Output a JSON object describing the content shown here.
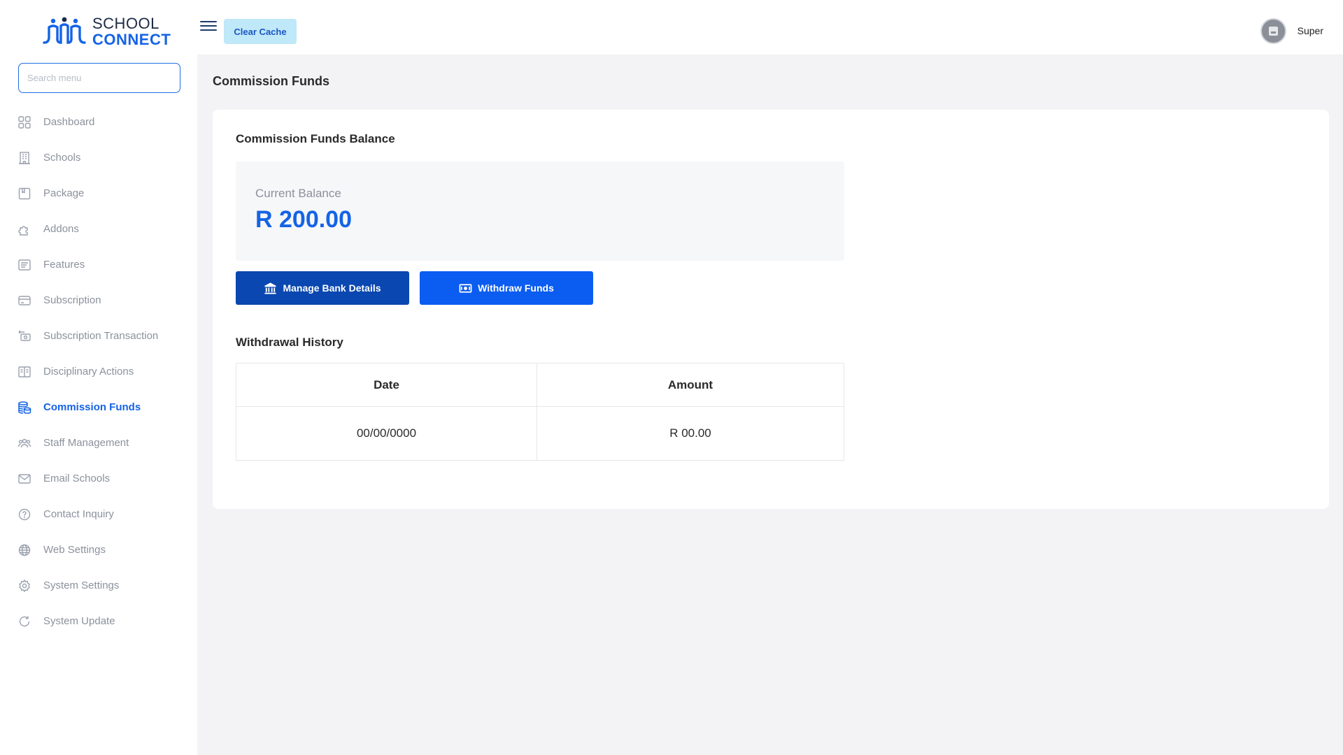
{
  "logo": {
    "line1": "SCHOOL",
    "line2": "CONNECT",
    "brand_color": "#1563e6"
  },
  "sidebar": {
    "search_placeholder": "Search menu",
    "items": [
      {
        "label": "Dashboard",
        "icon": "grid-icon",
        "active": false
      },
      {
        "label": "Schools",
        "icon": "building-icon",
        "active": false
      },
      {
        "label": "Package",
        "icon": "package-icon",
        "active": false
      },
      {
        "label": "Addons",
        "icon": "puzzle-icon",
        "active": false
      },
      {
        "label": "Features",
        "icon": "list-icon",
        "active": false
      },
      {
        "label": "Subscription",
        "icon": "card-icon",
        "active": false
      },
      {
        "label": "Subscription Transaction",
        "icon": "transaction-icon",
        "active": false
      },
      {
        "label": "Disciplinary Actions",
        "icon": "book-icon",
        "active": false
      },
      {
        "label": "Commission Funds",
        "icon": "coins-icon",
        "active": true
      },
      {
        "label": "Staff Management",
        "icon": "users-icon",
        "active": false
      },
      {
        "label": "Email Schools",
        "icon": "mail-icon",
        "active": false
      },
      {
        "label": "Contact Inquiry",
        "icon": "question-icon",
        "active": false
      },
      {
        "label": "Web Settings",
        "icon": "globe-icon",
        "active": false
      },
      {
        "label": "System Settings",
        "icon": "gear-icon",
        "active": false
      },
      {
        "label": "System Update",
        "icon": "refresh-icon",
        "active": false
      }
    ]
  },
  "header": {
    "clear_cache_label": "Clear Cache",
    "user_name": "Super"
  },
  "main": {
    "page_title": "Commission Funds",
    "card_title": "Commission Funds Balance",
    "balance_label": "Current Balance",
    "balance_value": "R 200.00",
    "manage_bank_label": "Manage Bank Details",
    "withdraw_label": "Withdraw Funds",
    "history_title": "Withdrawal History",
    "table": {
      "headers": [
        "Date",
        "Amount"
      ],
      "rows": [
        [
          "00/00/0000",
          "R 00.00"
        ]
      ]
    }
  }
}
